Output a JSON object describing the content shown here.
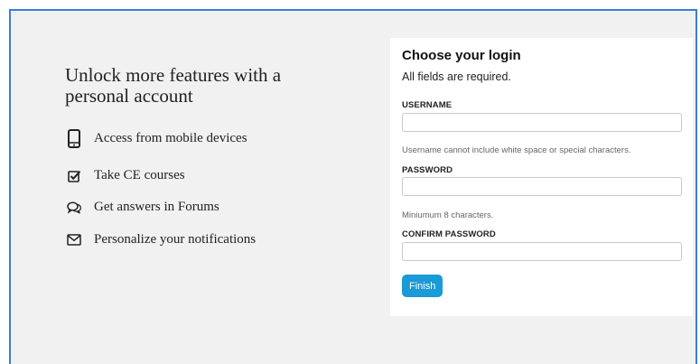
{
  "promo": {
    "headline_line1": "Unlock more features with a",
    "headline_line2": "personal account",
    "features": [
      {
        "label": "Access from mobile devices",
        "icon": "mobile-phone-icon"
      },
      {
        "label": "Take CE courses",
        "icon": "checkbox-icon"
      },
      {
        "label": "Get answers in Forums",
        "icon": "chat-bubbles-icon"
      },
      {
        "label": "Personalize your notifications",
        "icon": "envelope-icon"
      }
    ]
  },
  "login": {
    "title": "Choose your login",
    "subtitle": "All fields are required.",
    "username": {
      "label": "USERNAME",
      "value": "",
      "help": "Username cannot include white space or special characters."
    },
    "password": {
      "label": "PASSWORD",
      "value": "",
      "help": "Miniumum 8 characters."
    },
    "confirm": {
      "label": "CONFIRM PASSWORD",
      "value": ""
    },
    "submit_label": "Finish"
  },
  "colors": {
    "accent": "#1a9ad6",
    "frame_border": "#3b7dd8",
    "background": "#f1f1f1"
  }
}
